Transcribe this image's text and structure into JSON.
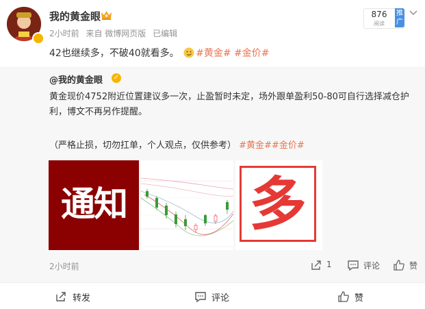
{
  "post": {
    "author": "我的黄金眼",
    "meta": {
      "time": "2小时前",
      "source": "来自 微博网页版",
      "edited": "已编辑"
    },
    "promo": {
      "count": "876",
      "sub": "阅读",
      "tag": "推广"
    },
    "text_main": "42也继续多，不破40就看多。",
    "tags": [
      "#黄金#",
      "#金价#"
    ]
  },
  "repost": {
    "author": "@我的黄金眼",
    "text": "黄金现价4752附近位置建议多一次，止盈暂时未定，场外跟单盈利50-80可自行选择减仓护利，博文不再另作提醒。",
    "note": "（严格止损，切勿扛单，个人观点，仅供参考）",
    "note_tags": "#黄金##金价#",
    "images": {
      "img1_text": "通知",
      "img3_text": "多"
    },
    "time": "2小时前",
    "actions": {
      "share_count": "1",
      "comment_label": "评论",
      "like_label": "赞"
    }
  },
  "footer": {
    "repost_label": "转发",
    "comment_label": "评论",
    "like_label": "赞"
  },
  "colors": {
    "tag": "#eb7350",
    "meta": "#939393",
    "repost_bg": "#f7f7f7",
    "notice_bg": "#8b0000",
    "duo_red": "#e53935"
  },
  "chart_data": {
    "type": "candlestick",
    "title": "",
    "candles_up": 4,
    "candles_down": 4
  }
}
